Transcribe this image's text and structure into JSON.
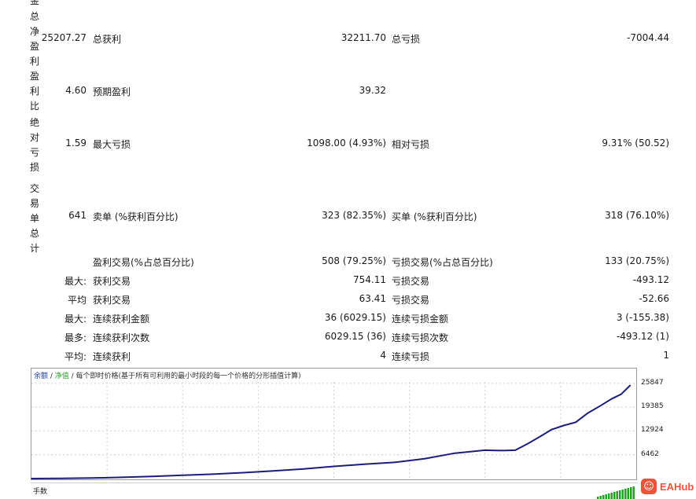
{
  "left_labels": {
    "top_partial": "金",
    "net_profit": [
      "总",
      "净",
      "盈",
      "利"
    ],
    "profit_factor": [
      "盈",
      "利",
      "比"
    ],
    "abs_drawdown": [
      "绝",
      "对",
      "亏",
      "损"
    ],
    "total_trades": [
      "交",
      "易",
      "单",
      "总",
      "计"
    ]
  },
  "rows": {
    "net_profit_value": "25207.27",
    "gross_profit_label": "总获利",
    "gross_profit_value": "32211.70",
    "gross_loss_label": "总亏损",
    "gross_loss_value": "-7004.44",
    "profit_factor_value": "4.60",
    "expected_payoff_label": "预期盈利",
    "expected_payoff_value": "39.32",
    "abs_drawdown_value": "1.59",
    "max_drawdown_label": "最大亏损",
    "max_drawdown_value": "1098.00 (4.93%)",
    "rel_drawdown_label": "相对亏损",
    "rel_drawdown_value": "9.31% (50.52)",
    "total_trades_value": "641",
    "short_label": "卖单 (%获利百分比)",
    "short_value": "323 (82.35%)",
    "long_label": "买单 (%获利百分比)",
    "long_value": "318 (76.10%)"
  },
  "stats": [
    {
      "prefix": "",
      "l1": "盈利交易(%占总百分比)",
      "v1": "508 (79.25%)",
      "l2": "亏损交易(%占总百分比)",
      "v2": "133 (20.75%)"
    },
    {
      "prefix": "最大:",
      "l1": "获利交易",
      "v1": "754.11",
      "l2": "亏损交易",
      "v2": "-493.12"
    },
    {
      "prefix": "平均",
      "l1": "获利交易",
      "v1": "63.41",
      "l2": "亏损交易",
      "v2": "-52.66"
    },
    {
      "prefix": "最大:",
      "l1": "连续获利金额",
      "v1": "36 (6029.15)",
      "l2": "连续亏损金额",
      "v2": "3 (-155.38)"
    },
    {
      "prefix": "最多:",
      "l1": "连续获利次数",
      "v1": "6029.15 (36)",
      "l2": "连续亏损次数",
      "v2": "-493.12 (1)"
    },
    {
      "prefix": "平均:",
      "l1": "连续获利",
      "v1": "4",
      "l2": "连续亏损",
      "v2": "1"
    }
  ],
  "chart_data": {
    "type": "line",
    "title": "余额 / 净值 / 每个即时价格(基于所有可利用的最小时段的每一个价格的分形插值计算)",
    "legend_parts": [
      {
        "text": "余额",
        "color": "#1f3fa8"
      },
      {
        "text": " / ",
        "color": "#333333"
      },
      {
        "text": "净值",
        "color": "#2ea02e"
      },
      {
        "text": " / 每个即时价格(基于所有可利用的最小时段的每一个价格的分形插值计算)",
        "color": "#333333"
      }
    ],
    "ylim": [
      0,
      28800
    ],
    "yticks": [
      25847,
      19385,
      12924,
      6462
    ],
    "grid": true,
    "line_color": "#1b1d7a",
    "x": [
      0,
      5,
      10,
      15,
      20,
      25,
      30,
      35,
      40,
      45,
      50,
      55,
      60,
      65,
      70,
      75,
      78,
      80,
      82,
      84,
      86,
      88,
      90,
      92,
      94,
      96,
      97.5,
      99
    ],
    "series": [
      {
        "values": [
          0,
          40,
          150,
          350,
          600,
          900,
          1200,
          1600,
          2100,
          2600,
          3300,
          3900,
          4400,
          5400,
          6900,
          7700,
          7600,
          7700,
          9400,
          11300,
          13300,
          14400,
          15300,
          17800,
          19700,
          21700,
          22900,
          25300
        ]
      }
    ]
  },
  "bottom_strip": {
    "label": "手数",
    "bar_color": "#1fa31f"
  },
  "watermark": {
    "text": "EAHub"
  }
}
